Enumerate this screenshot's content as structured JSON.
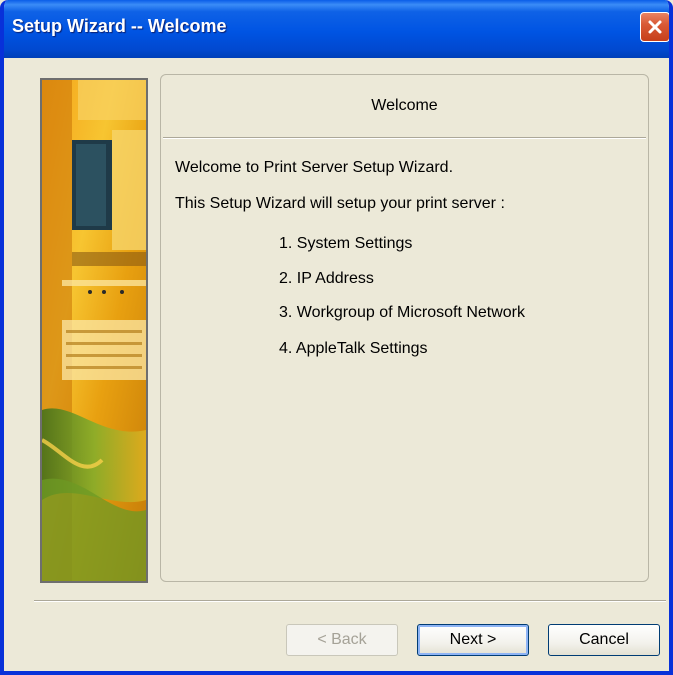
{
  "window": {
    "title": "Setup Wizard -- Welcome"
  },
  "panel": {
    "header": "Welcome",
    "intro": "Welcome to Print Server Setup Wizard.",
    "description": "This Setup Wizard will setup your print server :",
    "steps": [
      "1. System Settings",
      "2. IP Address",
      "3. Workgroup of Microsoft Network",
      "4. AppleTalk Settings"
    ]
  },
  "buttons": {
    "back": "< Back",
    "next": "Next >",
    "cancel": "Cancel"
  },
  "icons": {
    "close": "close-icon",
    "banner": "wizard-banner-image"
  },
  "colors": {
    "titlebar": "#0054e3",
    "close_button": "#d95a36",
    "dialog_background": "#ece9d8"
  }
}
